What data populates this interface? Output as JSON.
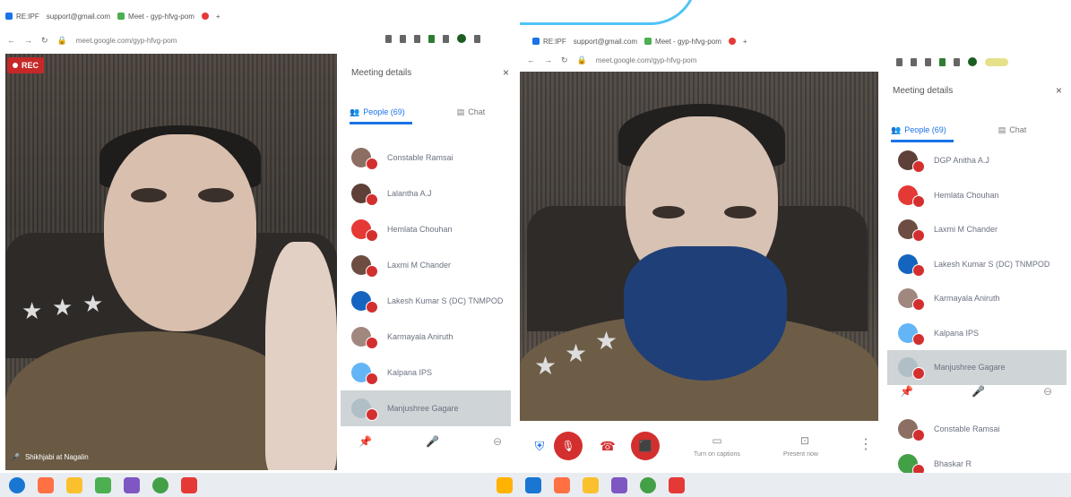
{
  "left_window": {
    "tabs": [
      {
        "label": "RE:IPF",
        "color": "#1a73e8"
      },
      {
        "label": "support@gmail.com",
        "color": "#555"
      },
      {
        "label": "Meet - gyp-hfvg-pom",
        "color": "#4caf50"
      }
    ],
    "url": "meet.google.com/gyp-hfvg-pom",
    "rec_label": "REC",
    "self_name": "Shikhjabi at Nagalin",
    "panel": {
      "title": "Meeting details",
      "close": "×",
      "people_tab": "People (69)",
      "chat_tab": "Chat",
      "participants": [
        {
          "name": "Constable Ramsai",
          "avatar": "#8d6e63"
        },
        {
          "name": "Lalantha A.J",
          "avatar": "#5d4037"
        },
        {
          "name": "Hemlata Chouhan",
          "avatar": "#e53935"
        },
        {
          "name": "Laxmi M Chander",
          "avatar": "#6d4c41"
        },
        {
          "name": "Lakesh Kumar S (DC) TNMPOD",
          "avatar": "#1565c0"
        },
        {
          "name": "Karmayala Aniruth",
          "avatar": "#a1887f"
        },
        {
          "name": "Kalpana IPS",
          "avatar": "#64b5f6"
        },
        {
          "name": "Manjushree Gagare",
          "avatar": "#b0bec5"
        }
      ]
    }
  },
  "right_window": {
    "tabs": [
      {
        "label": "RE:IPF",
        "color": "#1a73e8"
      },
      {
        "label": "support@gmail.com",
        "color": "#555"
      },
      {
        "label": "Meet - gyp-hfvg-pom",
        "color": "#4caf50"
      }
    ],
    "url": "meet.google.com/gyp-hfvg-pom",
    "controls": {
      "captions": "Turn on captions",
      "present": "Present now"
    },
    "panel": {
      "title": "Meeting details",
      "close": "×",
      "people_tab": "People (69)",
      "chat_tab": "Chat",
      "participants": [
        {
          "name": "DGP Anitha A.J",
          "avatar": "#5d4037"
        },
        {
          "name": "Hemlata Chouhan",
          "avatar": "#e53935"
        },
        {
          "name": "Laxmi M Chander",
          "avatar": "#6d4c41"
        },
        {
          "name": "Lakesh Kumar S (DC) TNMPOD",
          "avatar": "#1565c0"
        },
        {
          "name": "Karmayala Aniruth",
          "avatar": "#a1887f"
        },
        {
          "name": "Kalpana IPS",
          "avatar": "#64b5f6"
        },
        {
          "name": "Manjushree Gagare",
          "avatar": "#b0bec5"
        }
      ],
      "more": [
        {
          "name": "Constable Ramsai",
          "avatar": "#8d6e63"
        },
        {
          "name": "Bhaskar R",
          "avatar": "#43a047"
        }
      ]
    }
  },
  "taskbar": {
    "icons": [
      "windows-icon",
      "firefox-icon",
      "folder-icon",
      "gallery-icon",
      "paint-icon",
      "chrome-icon",
      "pdf-icon",
      "explorer-icon",
      "firefox-icon",
      "folder-icon",
      "star-icon",
      "paint-icon",
      "chrome-icon",
      "pdf-icon"
    ]
  }
}
